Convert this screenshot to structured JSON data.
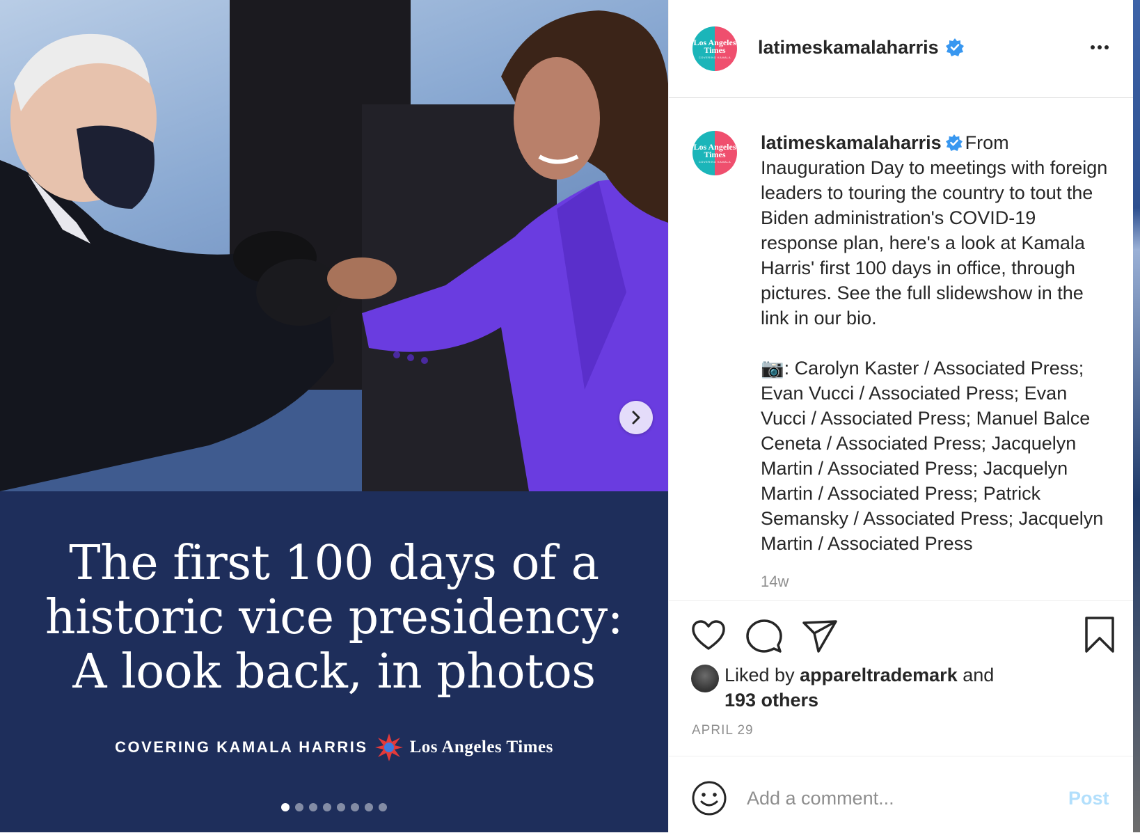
{
  "media": {
    "headline": "The first 100 days of a historic vice presidency: A look back, in photos",
    "brand_kicker": "COVERING KAMALA HARRIS",
    "brand_name": "Los Angeles Times",
    "carousel": {
      "total": 8,
      "active_index": 1
    },
    "next_icon": "chevron-right-icon"
  },
  "post": {
    "username": "latimeskamalaharris",
    "avatar_text": "Los Angeles Times",
    "avatar_subtext": "COVERING KAMALA",
    "verified_icon": "verified-badge-icon",
    "more_icon": "more-options-icon",
    "caption": "From Inauguration Day to meetings with foreign leaders to touring the country to tout the Biden administration's COVID-19 response plan, here's a look at Kamala Harris' first 100 days in office, through pictures. See the full slidewshow in the link in our bio.\n\n📷: Carolyn Kaster / Associated Press; Evan Vucci / Associated Press; Evan Vucci / Associated Press; Manuel Balce Ceneta / Associated Press; Jacquelyn Martin / Associated Press; Jacquelyn Martin / Associated Press; Patrick Semansky / Associated Press; Jacquelyn Martin / Associated Press",
    "time_ago": "14w",
    "liked_by_prefix": "Liked by",
    "liked_by_user": "appareltrademark",
    "liked_by_and": "and",
    "liked_by_others": "193 others",
    "date": "APRIL 29"
  },
  "actions": {
    "like_icon": "heart-icon",
    "comment_icon": "comment-bubble-icon",
    "share_icon": "paper-plane-icon",
    "save_icon": "bookmark-icon"
  },
  "comment": {
    "placeholder": "Add a comment...",
    "post_label": "Post",
    "emoji_icon": "emoji-smiley-icon"
  },
  "colors": {
    "panel_navy": "#1e2e5b",
    "blazer_purple": "#6a3ce0",
    "post_button_disabled": "#b2dffc",
    "verified_blue": "#3897f0",
    "muted_text": "#8e8e8e"
  }
}
